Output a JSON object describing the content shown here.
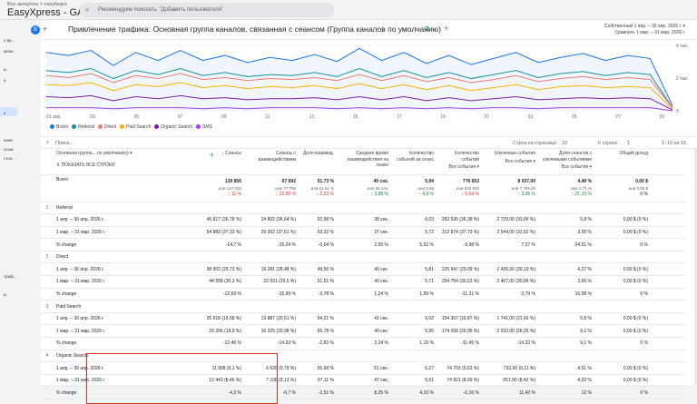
{
  "topbar": {
    "account": "Все аккаунты > easyfaqes",
    "title": "EasyXpress - GA4",
    "search_placeholder": "Рекомендуем поискать: \"Добавить пользователя\""
  },
  "leftnav": [
    "о вр...",
    "мени",
    "ы",
    "а",
    "к",
    "ение",
    "нсыи",
    "стон...",
    "траф...",
    "ы"
  ],
  "report": {
    "badge": "B",
    "title": "Привлечение трафика: Основная группа каналов, связанная с сеансом (Группа каналов по умолчанию)",
    "date_label": "Собственный",
    "date_range": "1 апр. – 30 апр. 2026 г.",
    "compare": "Сравнить 1 мар. – 31 мар. 2026 г."
  },
  "chart_data": {
    "type": "line",
    "x": [
      "01 апр.",
      "03",
      "05",
      "07",
      "09",
      "11",
      "13",
      "15",
      "17",
      "19",
      "21",
      "23",
      "25",
      "27",
      "29"
    ],
    "y_right_ticks": [
      "4 тыс.",
      "2 тыс.",
      "0"
    ],
    "series": [
      {
        "name": "Всего",
        "color": "#1a73e8",
        "values": [
          58,
          55,
          60,
          45,
          58,
          50,
          60,
          50,
          55,
          48,
          53,
          50,
          56,
          49,
          62,
          50,
          58,
          47,
          55,
          46,
          52,
          58,
          48,
          53,
          57,
          50,
          55,
          52,
          5
        ]
      },
      {
        "name": "Referral",
        "color": "#12939a",
        "values": [
          40,
          38,
          42,
          32,
          40,
          36,
          42,
          35,
          38,
          34,
          36,
          35,
          38,
          34,
          42,
          34,
          40,
          33,
          38,
          32,
          36,
          40,
          33,
          37,
          39,
          35,
          38,
          36,
          3
        ]
      },
      {
        "name": "Direct",
        "color": "#e67c73",
        "values": [
          35,
          33,
          37,
          28,
          35,
          32,
          37,
          31,
          33,
          30,
          32,
          31,
          33,
          30,
          36,
          30,
          35,
          29,
          33,
          28,
          31,
          35,
          29,
          32,
          34,
          31,
          33,
          31,
          3
        ]
      },
      {
        "name": "Paid Search",
        "color": "#f4b400",
        "values": [
          26,
          25,
          28,
          20,
          26,
          24,
          28,
          23,
          25,
          22,
          24,
          23,
          25,
          22,
          27,
          22,
          26,
          21,
          25,
          20,
          23,
          26,
          21,
          24,
          25,
          23,
          24,
          23,
          2
        ]
      },
      {
        "name": "Organic Search",
        "color": "#7b1fa2",
        "values": [
          14,
          13,
          15,
          10,
          14,
          12,
          15,
          12,
          13,
          11,
          12,
          12,
          13,
          11,
          14,
          11,
          14,
          10,
          13,
          10,
          12,
          14,
          11,
          12,
          13,
          12,
          13,
          12,
          1
        ]
      },
      {
        "name": "SMS",
        "color": "#a142f4",
        "values": [
          3,
          3,
          3,
          2,
          3,
          3,
          3,
          2,
          3,
          2,
          3,
          3,
          3,
          2,
          3,
          2,
          3,
          2,
          3,
          2,
          3,
          3,
          2,
          3,
          3,
          3,
          3,
          3,
          0
        ]
      }
    ]
  },
  "legend": [
    {
      "name": "Всего",
      "color": "#1a73e8"
    },
    {
      "name": "Referral",
      "color": "#12939a"
    },
    {
      "name": "Direct",
      "color": "#e67c73"
    },
    {
      "name": "Paid Search",
      "color": "#f4b400"
    },
    {
      "name": "Organic Search",
      "color": "#7b1fa2"
    },
    {
      "name": "SMS",
      "color": "#a142f4"
    }
  ],
  "tablebar": {
    "search": "Поиск...",
    "rows_per_page_label": "Строк на странице:",
    "rows_per_page": "10",
    "goto_label": "К строке",
    "goto": "1",
    "range": "1–10 из 16"
  },
  "table": {
    "dim_label": "Основная группа... по умолчанию)",
    "show_all": "ПОКАЗАТЬ ВСЕ СТРОКИ",
    "headers": [
      "↓ Сеансы",
      "Сеансы с взаимодействием",
      "Доля взаимод.",
      "Среднее время взаимодействия на сеанс",
      "Количество событий за сеанс",
      "Количество событий",
      "Ключевые события",
      "Доля сеансов с ключевыми событиями",
      "Общий доход"
    ],
    "subhdr": [
      "",
      "",
      "",
      "",
      "",
      "Все события",
      "Все события",
      "Все события",
      ""
    ],
    "total": {
      "label": "Всего",
      "vals": [
        "130 856",
        "67 692",
        "51,73 %",
        "40 сек.",
        "5,94",
        "776 653",
        "8 037,00",
        "4,49 %",
        "0,00 $"
      ],
      "sub": [
        "или 147 032",
        "или 77 798",
        "или 52,91 %",
        "или 38 сек.",
        "или 5,66",
        "или 832 004",
        "или 7 799,00",
        "или 3,71 %",
        "или 0,00 $"
      ],
      "chg": [
        "↓ 11 %",
        "↓ 12,99 %",
        "↓ 2,23 %",
        "↑ 3,88 %",
        "↑ 4,9 %",
        "↓ 6,64 %",
        "↑ 3,05 %",
        "↑ 21,15 %",
        "0 %"
      ]
    },
    "groups": [
      {
        "n": "1",
        "name": "Referral",
        "rows": [
          {
            "label": "1 апр. – 30 апр. 2026 г.",
            "vals": [
              "46 817 (35,78 %)",
              "24 802 (36,64 %)",
              "52,98 %",
              "38 сек.",
              "6,03",
              "282 536 (36,38 %)",
              "2 729,00 (33,96 %)",
              "5,8 %",
              "0,00 $ (0 %)"
            ]
          },
          {
            "label": "1 мар. – 31 мар. 2026 г.",
            "vals": [
              "54 883 (37,33 %)",
              "29 262 (37,61 %)",
              "53,32 %",
              "37 сек.",
              "5,72",
              "313 874 (37,73 %)",
              "2 544,00 (32,62 %)",
              "3,05 %",
              "0,00 $ (0 %)"
            ]
          },
          {
            "label": "% change",
            "vals": [
              "-14,7 %",
              "-15,24 %",
              "-0,64 %",
              "2,55 %",
              "5,52 %",
              "-9,98 %",
              "7,27 %",
              "24,51 %",
              "0 %"
            ]
          }
        ]
      },
      {
        "n": "2",
        "name": "Direct",
        "rows": [
          {
            "label": "1 апр. – 30 апр. 2026 г.",
            "vals": [
              "38 902 (29,73 %)",
              "19 281 (28,48 %)",
              "49,56 %",
              "40 сек.",
              "5,81",
              "225 947 (29,09 %)",
              "2 426,00 (30,19 %)",
              "4,27 %",
              "0,00 $ (0 %)"
            ]
          },
          {
            "label": "1 мар. – 31 мар. 2026 г.",
            "vals": [
              "44 558 (30,3 %)",
              "22 931 (29,5 %)",
              "51,51 %",
              "40 сек.",
              "5,71",
              "254 754 (30,62 %)",
              "2 407,00 (30,86 %)",
              "3,66 %",
              "0,00 $ (0 %)"
            ]
          },
          {
            "label": "% change",
            "vals": [
              "-12,69 %",
              "-15,99 %",
              "-3,78 %",
              "1,24 %",
              "1,59 %",
              "-11,31 %",
              "0,79 %",
              "16,58 %",
              "0 %"
            ]
          }
        ]
      },
      {
        "n": "3",
        "name": "Paid Search",
        "rows": [
          {
            "label": "1 апр. – 30 апр. 2026 г.",
            "vals": [
              "25 618 (19,58 %)",
              "13 887 (20,51 %)",
              "54,21 %",
              "41 сек.",
              "6,02",
              "154 307 (19,87 %)",
              "1 741,00 (21,66 %)",
              "5,8 %",
              "0,00 $ (0 %)"
            ]
          },
          {
            "label": "1 мар. – 31 мар. 2026 г.",
            "vals": [
              "29 266 (19,9 %)",
              "16 325 (20,98 %)",
              "55,78 %",
              "40 сек.",
              "5,95",
              "174 268 (20,95 %)",
              "2 032,00 (26,05 %)",
              "9,1 %",
              "0,00 $ (0 %)"
            ]
          },
          {
            "label": "% change",
            "vals": [
              "-12,46 %",
              "-14,93 %",
              "-2,82 %",
              "3,24 %",
              "1,15 %",
              "-11,45 %",
              "-14,32 %",
              "9,1 %",
              "0 %"
            ]
          }
        ]
      },
      {
        "n": "4",
        "name": "Organic Search",
        "rows": [
          {
            "label": "1 апр. – 30 апр. 2026 г.",
            "vals": [
              "11 908 (9,1 %)",
              "6 630 (9,79 %)",
              "55,68 %",
              "51 сек.",
              "6,27",
              "74 703 (9,62 %)",
              "732,00 (9,11 %)",
              "4,51 %",
              "0,00 $ (0 %)"
            ]
          },
          {
            "label": "1 мар. – 31 мар. 2026 г.",
            "vals": [
              "12 443 (8,46 %)",
              "7 106 (9,13 %)",
              "57,11 %",
              "47 сек.",
              "6,01",
              "74 821 (8,99 %)",
              "657,00 (8,42 %)",
              "4,03 %",
              "0,00 $ (0 %)"
            ]
          },
          {
            "label": "% change",
            "vals": [
              "-4,3 %",
              "-6,7 %",
              "-2,51 %",
              "8,25 %",
              "4,33 %",
              "-0,16 %",
              "11,42 %",
              "12 %",
              "0 %"
            ]
          }
        ]
      }
    ]
  }
}
